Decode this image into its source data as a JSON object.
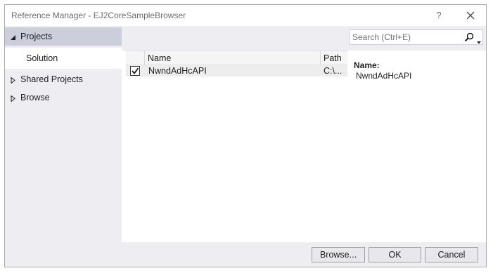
{
  "window": {
    "title": "Reference Manager - EJ2CoreSampleBrowser",
    "help_label": "?"
  },
  "sidebar": {
    "items": [
      {
        "label": "Projects",
        "state": "expanded"
      },
      {
        "label": "Solution",
        "state": "selected"
      },
      {
        "label": "Shared Projects",
        "state": "collapsed"
      },
      {
        "label": "Browse",
        "state": "collapsed"
      }
    ]
  },
  "search": {
    "placeholder": "Search (Ctrl+E)",
    "value": ""
  },
  "grid": {
    "columns": [
      "Name",
      "Path"
    ],
    "rows": [
      {
        "checked": true,
        "name": "NwndAdHcAPI",
        "path": "C:\\..."
      }
    ]
  },
  "details": {
    "name_label": "Name:",
    "name_value": "NwndAdHcAPI"
  },
  "buttons": {
    "browse": "Browse...",
    "ok": "OK",
    "cancel": "Cancel"
  },
  "colors": {
    "sidebar_bg": "#eeeef2",
    "selected_group": "#cccedb",
    "row_bg": "#ededed"
  }
}
